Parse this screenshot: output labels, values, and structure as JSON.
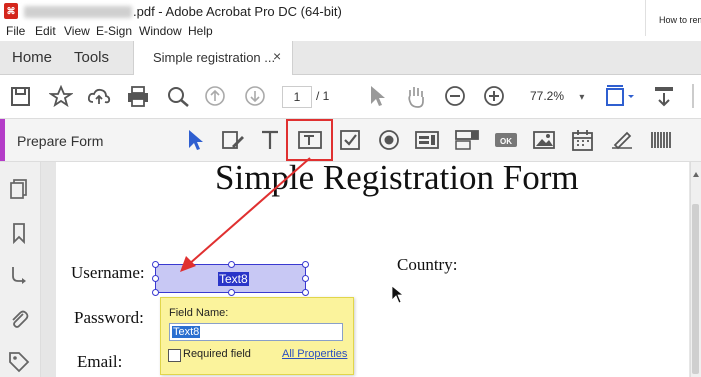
{
  "window": {
    "title_suffix": ".pdf - Adobe Acrobat Pro DC (64-bit)",
    "corner_text": "How to rem",
    "app_logo_icon": "acrobat-icon"
  },
  "menu": [
    "File",
    "Edit",
    "View",
    "E-Sign",
    "Window",
    "Help"
  ],
  "tabs": {
    "home": "Home",
    "tools": "Tools",
    "document": "Simple registration ...",
    "close": "×"
  },
  "toolbar": {
    "icons": [
      "save-icon",
      "bookmark-star-icon",
      "cloud-upload-icon",
      "print-icon",
      "search-icon",
      "page-up-icon",
      "page-down-icon",
      "select-cursor-icon",
      "hand-icon",
      "zoom-out-icon",
      "zoom-in-icon",
      "fit-page-icon",
      "more-tools-icon"
    ],
    "page_current": "1",
    "page_total": "/ 1",
    "zoom": "77.2%",
    "zoom_caret": "▾"
  },
  "prepare_form": {
    "label": "Prepare Form",
    "highlight_color": "#e03030",
    "accent_color": "#b43cc8"
  },
  "document": {
    "title": "Simple Registration Form",
    "labels": {
      "username": "Username:",
      "password": "Password:",
      "email": "Email:",
      "country": "Country:"
    },
    "selected_field_text": "Text8"
  },
  "popup": {
    "field_name_label": "Field Name:",
    "field_name_value": "Text8",
    "required_label": "Required field",
    "properties_link": "All Properties"
  }
}
